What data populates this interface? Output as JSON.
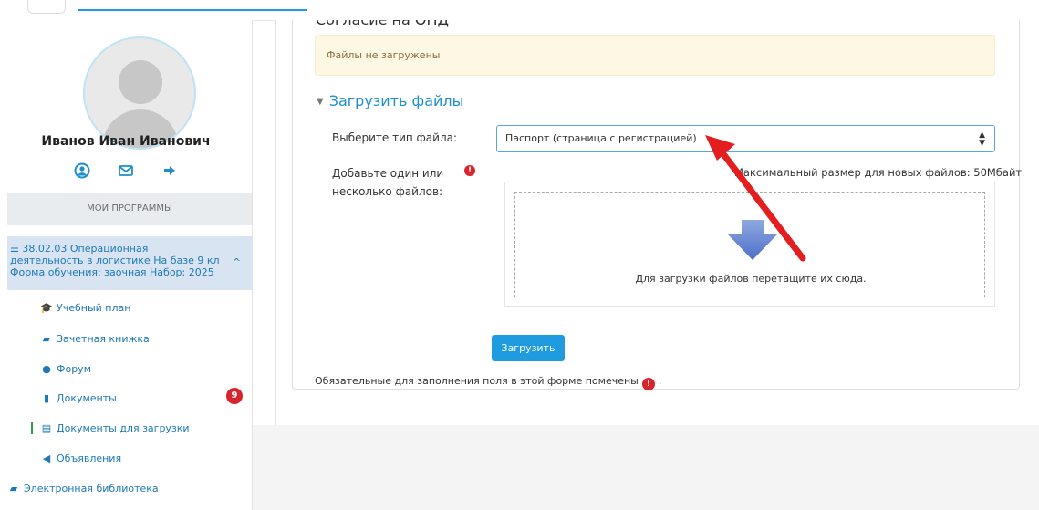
{
  "sidebar": {
    "user_name": "Иванов Иван Иванович",
    "user_icons": [
      "profile-icon",
      "mail-icon",
      "logout-icon"
    ],
    "programs_header": "МОИ ПРОГРАММЫ",
    "course": {
      "label": "38.02.03 Операционная деятельность в логистике На базе 9 кл Форма обучения: заочная Набор: 2025",
      "icon": "list-icon"
    },
    "items": [
      {
        "label": "Учебный план",
        "icon": "graduation-cap-icon"
      },
      {
        "label": "Зачетная книжка",
        "icon": "book-icon"
      },
      {
        "label": "Форум",
        "icon": "comment-icon"
      },
      {
        "label": "Документы",
        "icon": "file-icon",
        "badge": "9"
      },
      {
        "label": "Документы для загрузки",
        "icon": "file-text-icon",
        "active": true
      },
      {
        "label": "Объявления",
        "icon": "bullhorn-icon"
      },
      {
        "label": "Электронная библиотека",
        "icon": "book-icon"
      }
    ]
  },
  "main": {
    "section_title": "Согласие на ОПД",
    "alert_text": "Файлы не загружены",
    "legend": "Загрузить файлы",
    "file_type_label": "Выберите тип файла:",
    "file_type_value": "Паспорт (страница с регистрацией)",
    "add_files_label_line1": "Добавьте один или",
    "add_files_label_line2": "несколько файлов:",
    "max_size": "Максимальный размер для новых файлов: 50Мбайт",
    "drop_text": "Для загрузки файлов перетащите их сюда.",
    "upload_button": "Загрузить",
    "required_note_pre": "Обязательные для заполнения поля в этой форме помечены",
    "required_note_post": "."
  },
  "colors": {
    "accent": "#1f9be0",
    "link": "#1d78b5",
    "danger": "#d9232d",
    "alert_bg": "#fcf8e3",
    "annotation_arrow": "#e41e1e"
  }
}
